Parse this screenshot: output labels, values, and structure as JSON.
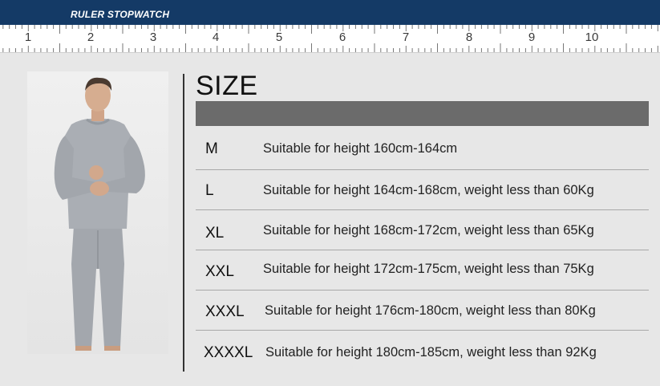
{
  "header": {
    "title": "RULER STOPWATCH"
  },
  "ruler": {
    "numbers": [
      "1",
      "2",
      "3",
      "4",
      "5",
      "6",
      "7",
      "8",
      "9",
      "10"
    ]
  },
  "table": {
    "heading": "SIZE",
    "rows": [
      {
        "size": "M",
        "desc": "Suitable for height 160cm-164cm"
      },
      {
        "size": "L",
        "desc": "Suitable for height 164cm-168cm, weight less than 60Kg"
      },
      {
        "size": "XL",
        "desc": "Suitable for height 168cm-172cm, weight less than 65Kg"
      },
      {
        "size": "XXL",
        "desc": "Suitable for height 172cm-175cm, weight less than 75Kg"
      },
      {
        "size": "XXXL",
        "desc": "Suitable for height 176cm-180cm, weight less than 80Kg"
      },
      {
        "size": "XXXXL",
        "desc": "Suitable for height 180cm-185cm, weight less than 92Kg"
      }
    ]
  },
  "colors": {
    "header_bg": "#143a66",
    "bar": "#6b6b6b",
    "garment": "#a9adb3"
  }
}
